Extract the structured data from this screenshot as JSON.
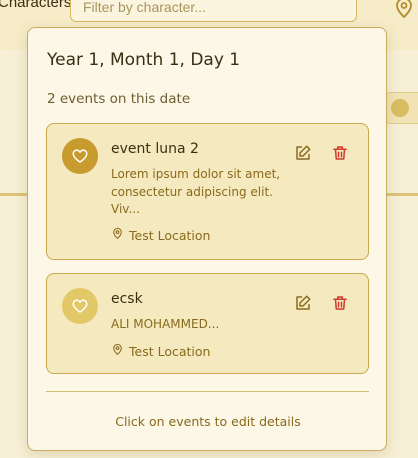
{
  "background": {
    "filter_label": "Characters:",
    "filter_placeholder": "Filter by character..."
  },
  "popover": {
    "title": "Year 1, Month 1, Day 1",
    "event_count": "2 events on this date",
    "events": [
      {
        "title": "event luna 2",
        "description": "Lorem ipsum dolor sit amet, consectetur adipiscing elit. Viv...",
        "location": "Test Location",
        "icon": "heart-icon",
        "accent": "#c89b2e"
      },
      {
        "title": "ecsk",
        "description": "ALI MOHAMMED...",
        "location": "Test Location",
        "icon": "heart-icon",
        "accent": "#e3c868"
      }
    ],
    "footer_hint": "Click on events to edit details"
  },
  "colors": {
    "edit": "#8a6a1c",
    "delete": "#d23a2a"
  }
}
